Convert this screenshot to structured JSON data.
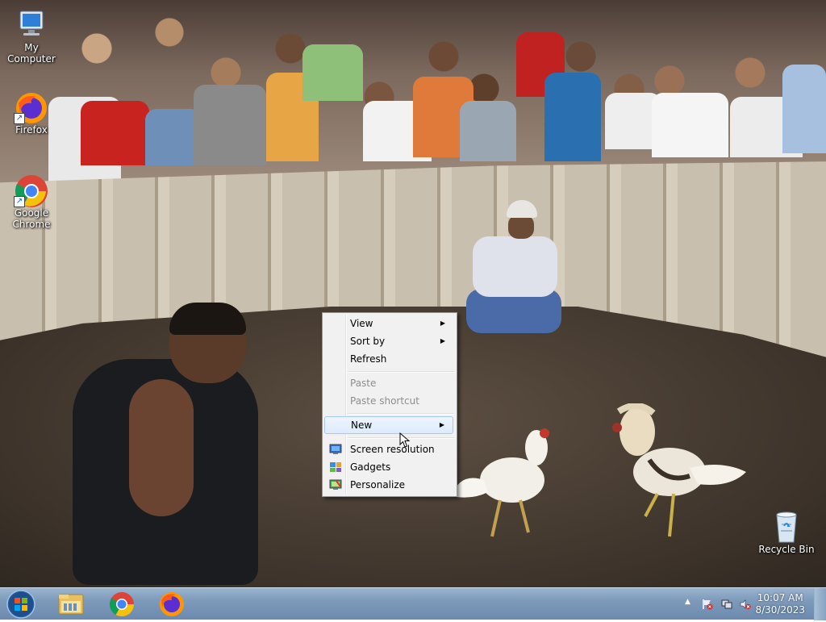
{
  "desktop": {
    "icons": [
      {
        "label": "My Computer"
      },
      {
        "label": "Firefox"
      },
      {
        "label": "Google Chrome"
      },
      {
        "label": "Recycle Bin"
      }
    ]
  },
  "context_menu": {
    "items": [
      {
        "label": "View",
        "submenu": true,
        "enabled": true
      },
      {
        "label": "Sort by",
        "submenu": true,
        "enabled": true
      },
      {
        "label": "Refresh",
        "submenu": false,
        "enabled": true
      },
      {
        "label": "Paste",
        "submenu": false,
        "enabled": false
      },
      {
        "label": "Paste shortcut",
        "submenu": false,
        "enabled": false
      },
      {
        "label": "New",
        "submenu": true,
        "enabled": true,
        "highlighted": true
      },
      {
        "label": "Screen resolution",
        "icon": "display-icon",
        "enabled": true
      },
      {
        "label": "Gadgets",
        "icon": "gadgets-icon",
        "enabled": true
      },
      {
        "label": "Personalize",
        "icon": "personalize-icon",
        "enabled": true
      }
    ],
    "submenu_arrow": "▶"
  },
  "taskbar": {
    "start_icon": "windows-start-icon",
    "pinned": [
      {
        "name": "explorer-icon"
      },
      {
        "name": "chrome-icon"
      },
      {
        "name": "firefox-icon"
      }
    ],
    "tray": {
      "expand_arrow": "▲",
      "time": "10:07 AM",
      "date": "8/30/2023"
    }
  },
  "colors": {
    "taskbar": "#7d9abb",
    "menu_bg": "#f1f1f1",
    "menu_highlight": "#dcebfc"
  }
}
